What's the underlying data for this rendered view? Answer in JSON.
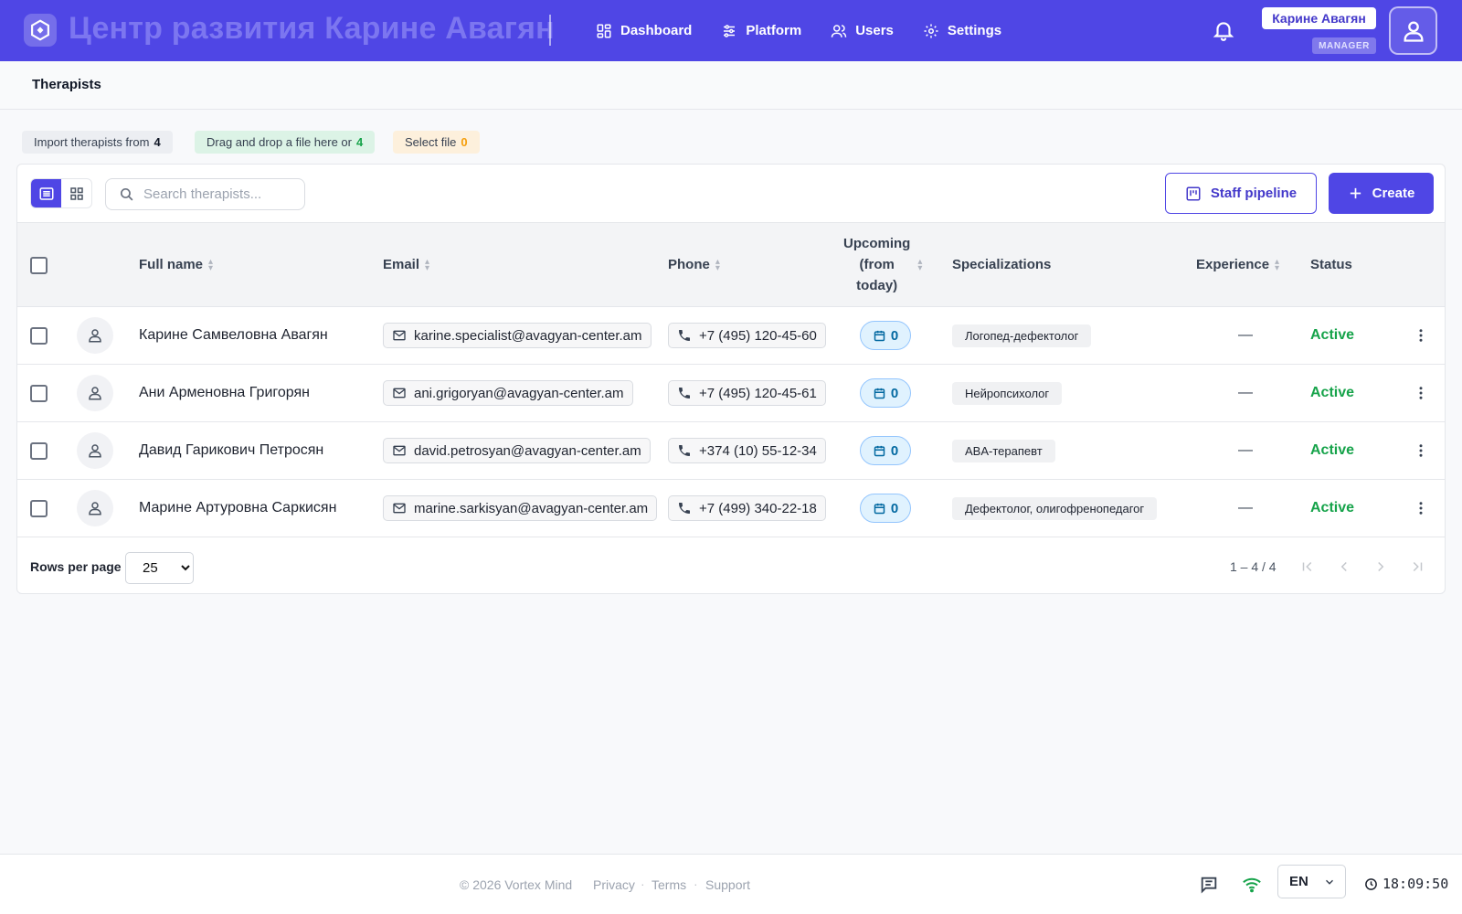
{
  "header": {
    "brand": "Центр развития Карине Авагян",
    "nav": [
      "Dashboard",
      "Platform",
      "Users",
      "Settings"
    ],
    "user_name": "Карине Авагян",
    "role": "MANAGER",
    "accent": "#4f46e5"
  },
  "page": {
    "title": "Therapists"
  },
  "import": {
    "import_label": "Import therapists from",
    "import_count": "4",
    "drop_label": "Drag and drop a file here or",
    "drop_count": "4",
    "select_label": "Select file",
    "select_count": "0"
  },
  "toolbar": {
    "search_placeholder": "Search therapists...",
    "pipeline_label": "Staff pipeline",
    "create_label": "Create"
  },
  "table": {
    "columns": {
      "full_name": "Full name",
      "email": "Email",
      "phone": "Phone",
      "upcoming_1": "Upcoming",
      "upcoming_2": "(from",
      "upcoming_3": "today)",
      "specializations": "Specializations",
      "experience": "Experience",
      "status": "Status"
    },
    "rows": [
      {
        "name": "Карине Самвеловна Авагян",
        "email": "karine.specialist@avagyan-center.am",
        "phone": "+7 (495) 120-45-60",
        "upcoming": "0",
        "spec": "Логопед-дефектолог",
        "experience": "—",
        "status": "Active"
      },
      {
        "name": "Ани Арменовна Григорян",
        "email": "ani.grigoryan@avagyan-center.am",
        "phone": "+7 (495) 120-45-61",
        "upcoming": "0",
        "spec": "Нейропсихолог",
        "experience": "—",
        "status": "Active"
      },
      {
        "name": "Давид Гарикович Петросян",
        "email": "david.petrosyan@avagyan-center.am",
        "phone": "+374 (10) 55-12-34",
        "upcoming": "0",
        "spec": "ABA-терапевт",
        "experience": "—",
        "status": "Active"
      },
      {
        "name": "Марине Артуровна Саркисян",
        "email": "marine.sarkisyan@avagyan-center.am",
        "phone": "+7 (499) 340-22-18",
        "upcoming": "0",
        "spec": "Дефектолог, олигофренопедагог",
        "experience": "—",
        "status": "Active"
      }
    ]
  },
  "pagination": {
    "rows_label": "Rows per page",
    "rows_value": "25",
    "range": "1 – 4 / 4"
  },
  "footer": {
    "copyright": "© 2026 Vortex Mind",
    "links": [
      "Privacy",
      "Terms",
      "Support"
    ],
    "lang": "EN",
    "time": "18:09:50"
  }
}
